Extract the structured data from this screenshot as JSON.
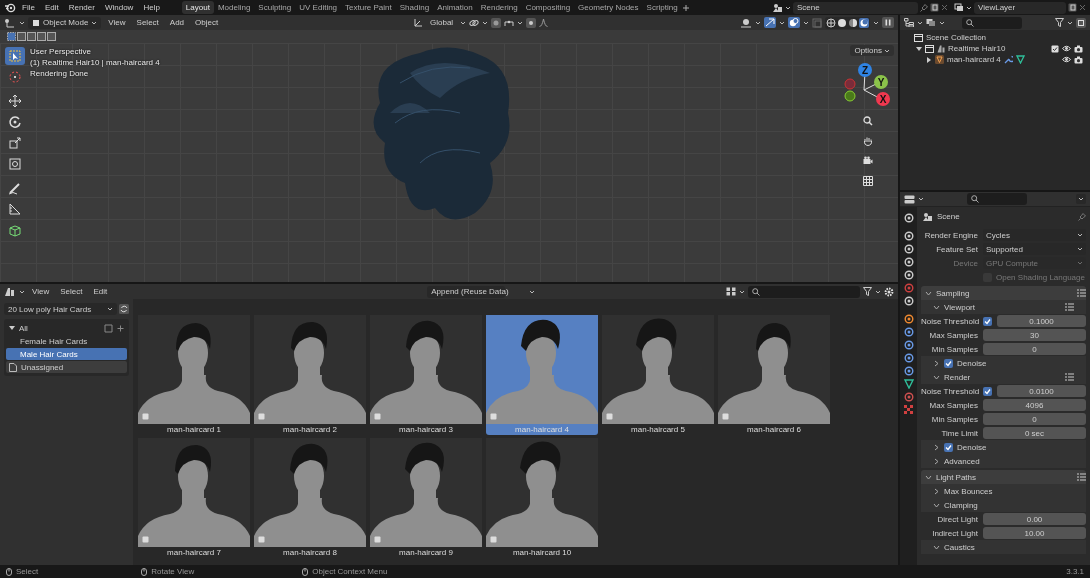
{
  "menu": [
    "File",
    "Edit",
    "Render",
    "Window",
    "Help"
  ],
  "workspaces": [
    {
      "label": "Layout",
      "selected": true
    },
    {
      "label": "Modeling",
      "selected": false
    },
    {
      "label": "Sculpting",
      "selected": false
    },
    {
      "label": "UV Editing",
      "selected": false
    },
    {
      "label": "Texture Paint",
      "selected": false
    },
    {
      "label": "Shading",
      "selected": false
    },
    {
      "label": "Animation",
      "selected": false
    },
    {
      "label": "Rendering",
      "selected": false
    },
    {
      "label": "Compositing",
      "selected": false
    },
    {
      "label": "Geometry Nodes",
      "selected": false
    },
    {
      "label": "Scripting",
      "selected": false
    }
  ],
  "scene": "Scene",
  "view_layer": "ViewLayer",
  "viewport": {
    "mode": "Object Mode",
    "menu": [
      "View",
      "Select",
      "Add",
      "Object"
    ],
    "orientation": "Global",
    "options": "Options",
    "overlay_lines": [
      "User Perspective",
      "(1) Realtime Hair10 | man-haircard 4",
      "Rendering Done"
    ],
    "gizmo_axes": [
      "Z",
      "Y",
      "X"
    ]
  },
  "outliner": {
    "root": "Scene Collection",
    "items": [
      {
        "label": "Realtime Hair10",
        "expanded": true,
        "children": [
          {
            "label": "man-haircard 4",
            "expanded": false
          }
        ]
      }
    ]
  },
  "assets": {
    "menu": [
      "View",
      "Select",
      "Edit"
    ],
    "import_mode": "Append (Reuse Data)",
    "library": "20 Low poly Hair Cards",
    "catalog_root": {
      "label": "All",
      "expanded": true
    },
    "catalogs": [
      {
        "label": "Female Hair Cards",
        "selected": false
      },
      {
        "label": "Male Hair Cards",
        "selected": true
      }
    ],
    "unassigned": "Unassigned",
    "items": [
      {
        "label": "man-haircard 1",
        "selected": false
      },
      {
        "label": "man-haircard 2",
        "selected": false
      },
      {
        "label": "man-haircard 3",
        "selected": false
      },
      {
        "label": "man-haircard 4",
        "selected": true
      },
      {
        "label": "man-haircard 5",
        "selected": false
      },
      {
        "label": "man-haircard 6",
        "selected": false
      },
      {
        "label": "man-haircard 7",
        "selected": false
      },
      {
        "label": "man-haircard 8",
        "selected": false
      },
      {
        "label": "man-haircard 9",
        "selected": false
      },
      {
        "label": "man-haircard 10",
        "selected": false
      }
    ]
  },
  "properties": {
    "title": "Scene",
    "rows": [
      {
        "kind": "dropdown",
        "label": "Render Engine",
        "value": "Cycles",
        "disabled": false
      },
      {
        "kind": "dropdown",
        "label": "Feature Set",
        "value": "Supported",
        "disabled": false
      },
      {
        "kind": "dropdown",
        "label": "Device",
        "value": "GPU Compute",
        "disabled": true
      },
      {
        "kind": "check",
        "label": "Open Shading Language",
        "checked": false,
        "disabled": true
      },
      {
        "kind": "panel",
        "label": "Sampling",
        "expanded": true
      },
      {
        "kind": "subpanel",
        "label": "Viewport",
        "expanded": true
      },
      {
        "kind": "threshold",
        "label": "Noise Threshold",
        "checked": true,
        "value": "0.1000"
      },
      {
        "kind": "number",
        "label": "Max Samples",
        "value": "30"
      },
      {
        "kind": "number",
        "label": "Min Samples",
        "value": "0"
      },
      {
        "kind": "subcheck",
        "label": "Denoise",
        "checked": true,
        "expanded": false
      },
      {
        "kind": "subpanel",
        "label": "Render",
        "expanded": true
      },
      {
        "kind": "threshold",
        "label": "Noise Threshold",
        "checked": true,
        "value": "0.0100"
      },
      {
        "kind": "number",
        "label": "Max Samples",
        "value": "4096"
      },
      {
        "kind": "number",
        "label": "Min Samples",
        "value": "0"
      },
      {
        "kind": "number",
        "label": "Time Limit",
        "value": "0 sec"
      },
      {
        "kind": "subcheck",
        "label": "Denoise",
        "checked": true,
        "expanded": false
      },
      {
        "kind": "subpanel",
        "label": "Advanced",
        "expanded": false
      },
      {
        "kind": "panel",
        "label": "Light Paths",
        "expanded": true
      },
      {
        "kind": "subpanel",
        "label": "Max Bounces",
        "expanded": false
      },
      {
        "kind": "subpanel",
        "label": "Clamping",
        "expanded": true
      },
      {
        "kind": "number",
        "label": "Direct Light",
        "value": "0.00"
      },
      {
        "kind": "number",
        "label": "Indirect Light",
        "value": "10.00"
      },
      {
        "kind": "subpanel",
        "label": "Caustics",
        "expanded": true
      }
    ]
  },
  "status": [
    "Select",
    "Rotate View",
    "Object Context Menu"
  ],
  "version": "3.3.1"
}
